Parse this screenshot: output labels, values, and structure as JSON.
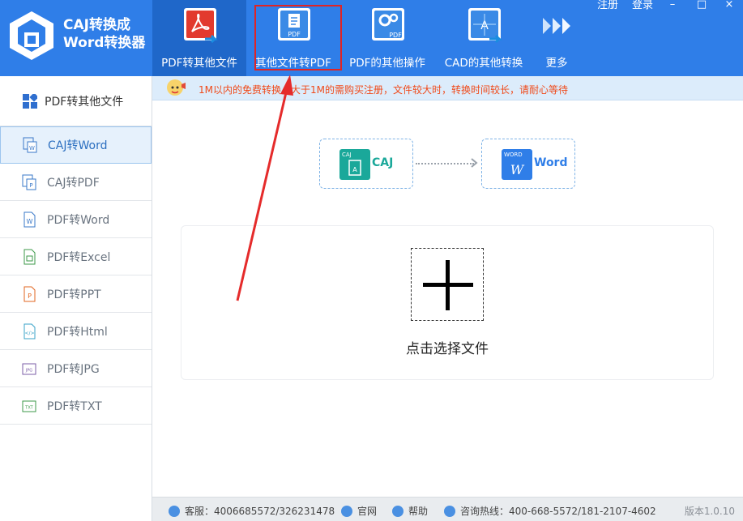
{
  "app": {
    "brand_line1": "CAJ转换成",
    "brand_line2": "Word转换器"
  },
  "window": {
    "register": "注册",
    "login": "登录",
    "minimize": "–",
    "restore": "□",
    "close": "×"
  },
  "nav": [
    {
      "label": "PDF转其他文件",
      "icon": "pdf-acrobat-icon",
      "active": true
    },
    {
      "label": "其他文件转PDF",
      "icon": "file-to-pdf-icon",
      "active": false
    },
    {
      "label": "PDF的其他操作",
      "icon": "pdf-gear-icon",
      "active": false
    },
    {
      "label": "CAD的其他转换",
      "icon": "cad-icon",
      "active": false
    },
    {
      "label": "更多",
      "icon": "more-arrows-icon",
      "active": false
    }
  ],
  "sidebar": {
    "header": "PDF转其他文件",
    "items": [
      {
        "label": "CAJ转Word",
        "active": true
      },
      {
        "label": "CAJ转PDF"
      },
      {
        "label": "PDF转Word"
      },
      {
        "label": "PDF转Excel"
      },
      {
        "label": "PDF转PPT"
      },
      {
        "label": "PDF转Html"
      },
      {
        "label": "PDF转JPG"
      },
      {
        "label": "PDF转TXT"
      }
    ]
  },
  "notice": "1M以内的免费转换，大于1M的需购买注册，文件较大时，转换时间较长，请耐心等待",
  "conversion": {
    "from": "CAJ",
    "from_tag": "CAJ",
    "to": "Word",
    "to_tag": "WORD"
  },
  "dropzone": {
    "label": "点击选择文件"
  },
  "footer": {
    "service": "客服：4006685572/326231478",
    "website": "官网",
    "help": "帮助",
    "hotline": "咨询热线：400-668-5572/181-2107-4602",
    "version": "版本1.0.10"
  },
  "colors": {
    "header_bg": "#2f7ee8",
    "header_active": "#1f67c9",
    "notice_text": "#f04a1a",
    "highlight": "#e02424"
  }
}
